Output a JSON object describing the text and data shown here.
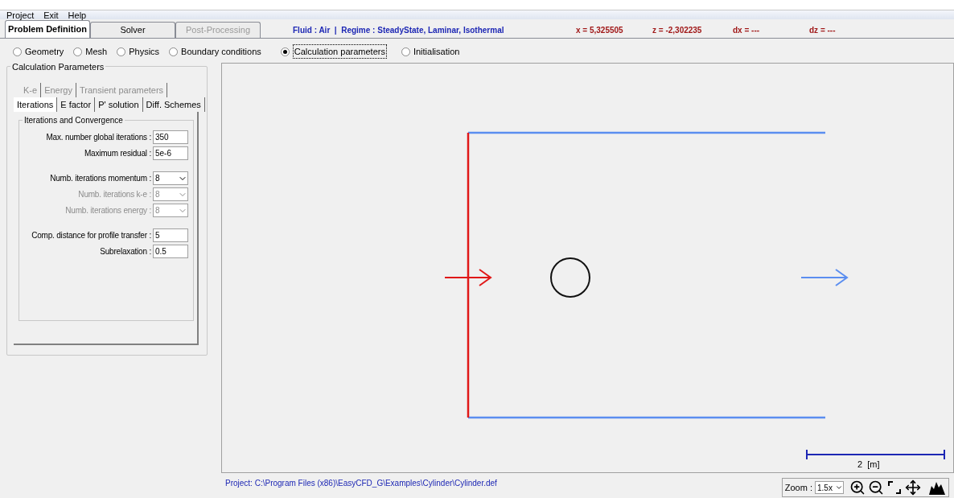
{
  "menu": [
    "Project",
    "Exit",
    "Help"
  ],
  "tabs": [
    {
      "label": "Problem Definition",
      "selected": true,
      "disabled": false
    },
    {
      "label": "Solver",
      "selected": false,
      "disabled": false
    },
    {
      "label": "Post-Processing",
      "selected": false,
      "disabled": true
    }
  ],
  "status": {
    "fluid": "Fluid : Air  |  Regime : SteadyState, Laminar, Isothermal",
    "x": "x = 5,325505",
    "z": "z = -2,302235",
    "dx": "dx = ---",
    "dz": "dz = ---"
  },
  "radios": [
    {
      "label": "Geometry",
      "selected": false
    },
    {
      "label": "Mesh",
      "selected": false
    },
    {
      "label": "Physics",
      "selected": false
    },
    {
      "label": "Boundary conditions",
      "selected": false
    },
    {
      "label": "Calculation parameters",
      "selected": true
    },
    {
      "label": "Initialisation",
      "selected": false
    }
  ],
  "panel": {
    "title": "Calculation Parameters",
    "tab_rows": [
      [
        {
          "label": "K-e",
          "selected": false,
          "disabled": true
        },
        {
          "label": "Energy",
          "selected": false,
          "disabled": true
        },
        {
          "label": "Transient parameters",
          "selected": false,
          "disabled": true
        }
      ],
      [
        {
          "label": "Iterations",
          "selected": true,
          "disabled": false
        },
        {
          "label": "E factor",
          "selected": false,
          "disabled": false
        },
        {
          "label": "P' solution",
          "selected": false,
          "disabled": false
        },
        {
          "label": "Diff. Schemes",
          "selected": false,
          "disabled": false
        }
      ]
    ],
    "group_title": "Iterations and Convergence",
    "field_groups": [
      [
        {
          "kind": "text",
          "label": "Max. number global iterations :",
          "value": "350",
          "disabled": false
        },
        {
          "kind": "text",
          "label": "Maximum residual :",
          "value": "5e-6",
          "disabled": false
        }
      ],
      [
        {
          "kind": "select",
          "label": "Numb. iterations momentum :",
          "value": "8",
          "disabled": false
        },
        {
          "kind": "select",
          "label": "Numb. iterations k-e :",
          "value": "8",
          "disabled": true
        },
        {
          "kind": "select",
          "label": "Numb. iterations energy :",
          "value": "8",
          "disabled": true
        }
      ],
      [
        {
          "kind": "text",
          "label": "Comp. distance for profile transfer :",
          "value": "5",
          "disabled": false
        },
        {
          "kind": "text",
          "label": "Subrelaxation :",
          "value": "0.5",
          "disabled": false
        }
      ]
    ]
  },
  "canvas": {
    "scale_label": "2  [m]"
  },
  "project_path": "Project: C:\\Program Files (x86)\\EasyCFD_G\\Examples\\Cylinder\\Cylinder.def",
  "zoom": {
    "label": "Zoom :",
    "value": "1.5x"
  }
}
